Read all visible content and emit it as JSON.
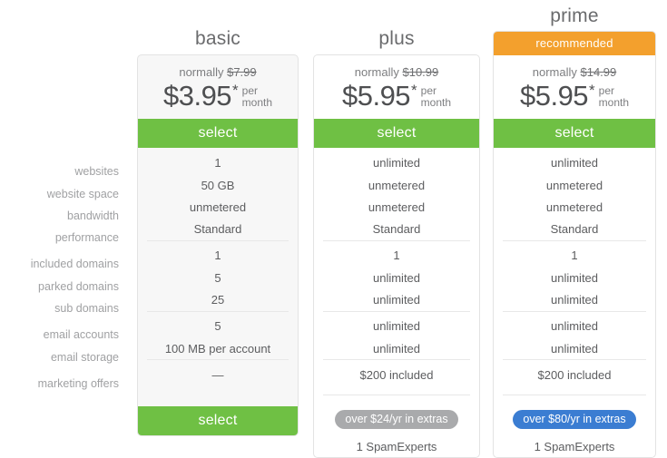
{
  "plans": [
    {
      "key": "basic",
      "title": "basic",
      "recommended_label": null,
      "normally_prefix": "normally ",
      "normally_price": "$7.99",
      "price": "$3.95",
      "star": "*",
      "per": "per",
      "month": "month",
      "select_label": "select",
      "select_label_bottom": "select",
      "badge": null,
      "badge_style": null,
      "spam_label": null,
      "values": [
        "1",
        "50 GB",
        "unmetered",
        "Standard",
        "1",
        "5",
        "25",
        "5",
        "100 MB per account",
        "—"
      ]
    },
    {
      "key": "plus",
      "title": "plus",
      "recommended_label": null,
      "normally_prefix": "normally ",
      "normally_price": "$10.99",
      "price": "$5.95",
      "star": "*",
      "per": "per",
      "month": "month",
      "select_label": "select",
      "select_label_bottom": null,
      "badge": "over $24/yr in extras",
      "badge_style": "grey",
      "spam_label": "1 SpamExperts",
      "values": [
        "unlimited",
        "unmetered",
        "unmetered",
        "Standard",
        "1",
        "unlimited",
        "unlimited",
        "unlimited",
        "unlimited",
        "$200 included"
      ]
    },
    {
      "key": "prime",
      "title": "prime",
      "recommended_label": "recommended",
      "normally_prefix": "normally ",
      "normally_price": "$14.99",
      "price": "$5.95",
      "star": "*",
      "per": "per",
      "month": "month",
      "select_label": "select",
      "select_label_bottom": null,
      "badge": "over $80/yr in extras",
      "badge_style": "blue",
      "spam_label": "1 SpamExperts",
      "values": [
        "unlimited",
        "unmetered",
        "unmetered",
        "Standard",
        "1",
        "unlimited",
        "unlimited",
        "unlimited",
        "unlimited",
        "$200 included"
      ]
    }
  ],
  "features": [
    "websites",
    "website space",
    "bandwidth",
    "performance",
    "included domains",
    "parked domains",
    "sub domains",
    "email accounts",
    "email storage",
    "marketing offers"
  ],
  "colors": {
    "green": "#6fc044",
    "orange": "#f3a02d",
    "blue": "#3b7dd2",
    "grey_pill": "#a9aaac",
    "card_grey": "#f7f7f7",
    "border": "#e3e3e3",
    "divider": "#e8e8e8",
    "label_text": "#a0a1a3",
    "value_text": "#5c5d5f"
  }
}
